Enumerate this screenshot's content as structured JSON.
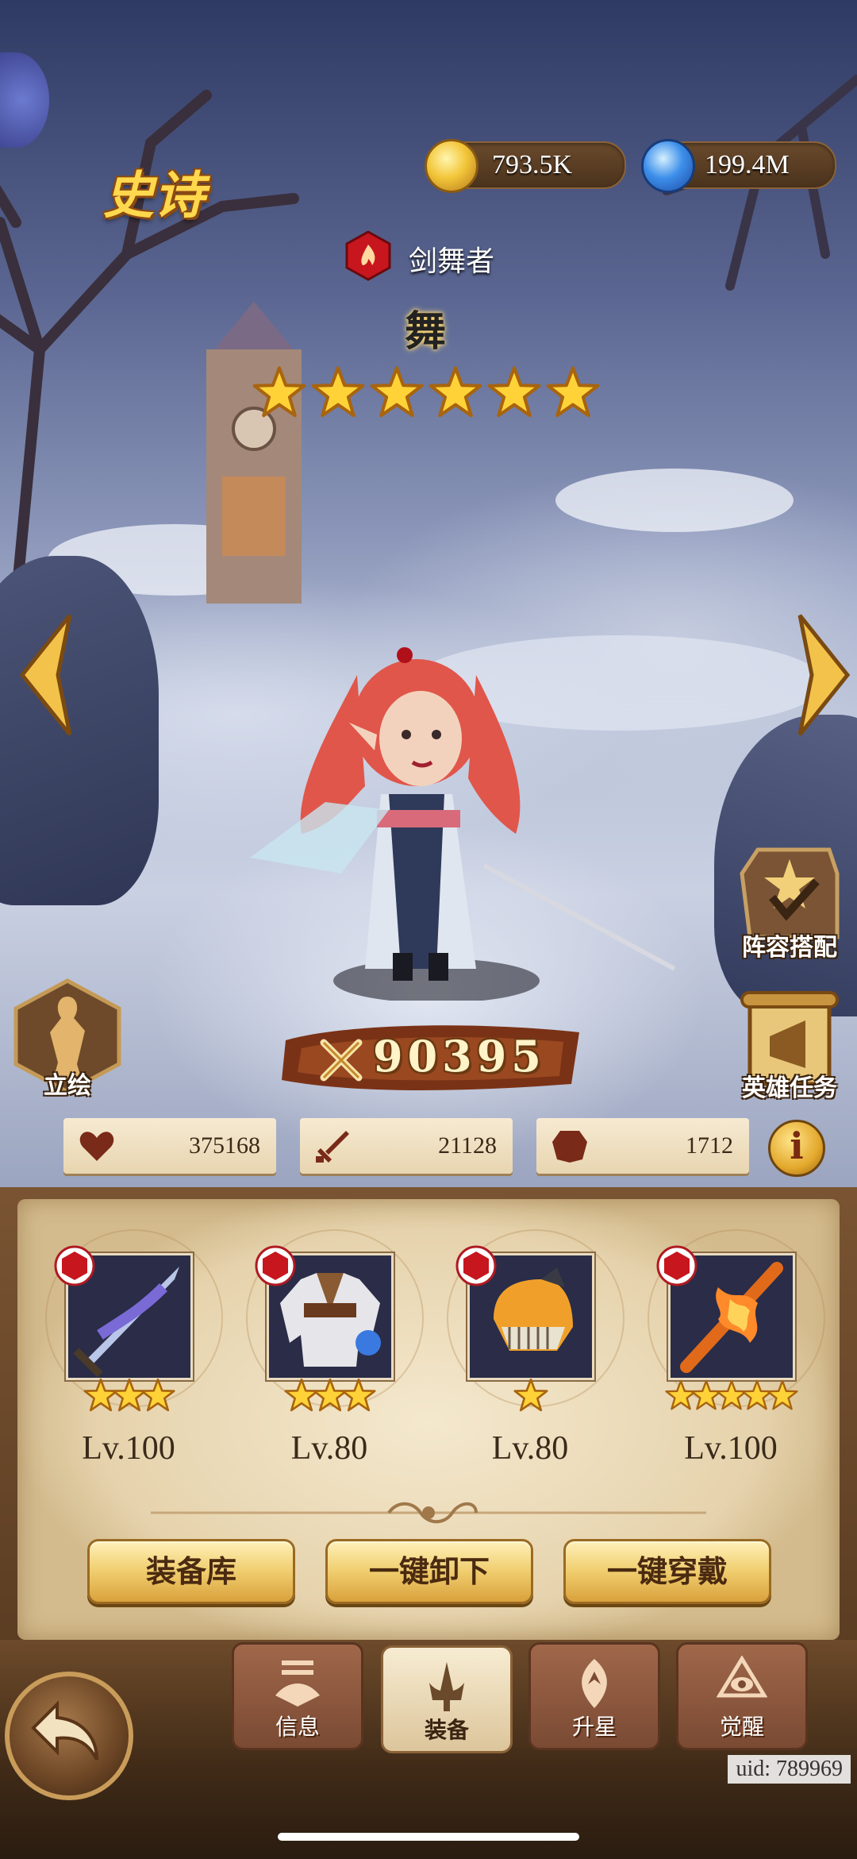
{
  "resources": {
    "gold": "793.5K",
    "potion": "199.4M"
  },
  "hero": {
    "rarity": "史诗",
    "class": "剑舞者",
    "name": "舞",
    "stars": 6,
    "power": "90395"
  },
  "stats": {
    "hp": "375168",
    "attack": "21128",
    "defense": "1712"
  },
  "side_buttons": {
    "portrait": "立绘",
    "formation": "阵容搭配",
    "hero_quest": "英雄任务"
  },
  "equipment": [
    {
      "stars": 3,
      "level": "Lv.100",
      "icon": "sword-icon"
    },
    {
      "stars": 3,
      "level": "Lv.80",
      "icon": "armor-icon"
    },
    {
      "stars": 1,
      "level": "Lv.80",
      "icon": "helmet-icon"
    },
    {
      "stars": 5,
      "level": "Lv.100",
      "icon": "flame-staff-icon"
    }
  ],
  "actions": {
    "armory": "装备库",
    "unequip_all": "一键卸下",
    "equip_all": "一键穿戴"
  },
  "tabs": [
    {
      "label": "信息",
      "active": false
    },
    {
      "label": "装备",
      "active": true
    },
    {
      "label": "升星",
      "active": false
    },
    {
      "label": "觉醒",
      "active": false
    }
  ],
  "uid": "uid: 789969",
  "colors": {
    "gold_text": "#ffd84d",
    "panel_bg": "#f4e8cd",
    "button_gold": "#f0cd6e"
  }
}
